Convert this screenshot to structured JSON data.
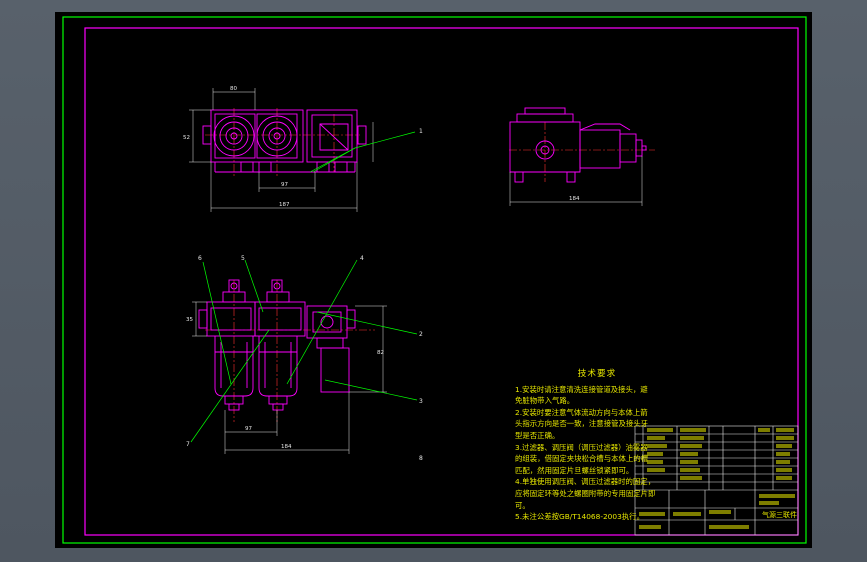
{
  "drawing": {
    "title": "气源三联件",
    "note_title": "技术要求",
    "notes": [
      "1.安装时请注意清洗连接管道及接头，避",
      "免脏物带入气路。",
      "2.安装时要注意气体流动方向与本体上箭",
      "头指示方向是否一致，注意接管及接头牙",
      "型是否正确。",
      "3.过滤器、调压阀（调压过滤器）油雾器",
      "的组装，借固定夹块松合槽与本体上的槽",
      "匹配，然用固定片旦螺丝锁紧即可。",
      "4.单独使用调压阀、调压过滤器时的固定，",
      "应将固定环等处之螺圈附带的专用固定片即",
      "可。",
      "5.未注公差按GB/T14068-2003执行。"
    ]
  },
  "callouts": [
    "1",
    "2",
    "3",
    "4",
    "5",
    "6",
    "7",
    "8"
  ],
  "dimensions": {
    "top_width": "80",
    "top_height": "52",
    "top_bottom1": "97",
    "top_bottom2": "187",
    "right_bottom": "184",
    "front_height": "35",
    "front_right": "82",
    "front_bottom1": "97",
    "front_bottom2": "184"
  },
  "colors": {
    "sheet": "#000000",
    "border": "#00ff00",
    "frame": "#ff00ff",
    "outline": "#ff00ff",
    "center": "#ff3030",
    "dimension": "#e8e8e8",
    "leader": "#00ff00",
    "text": "#e6e600",
    "table": "#e8e8e8",
    "table_text": "#e6e600"
  }
}
